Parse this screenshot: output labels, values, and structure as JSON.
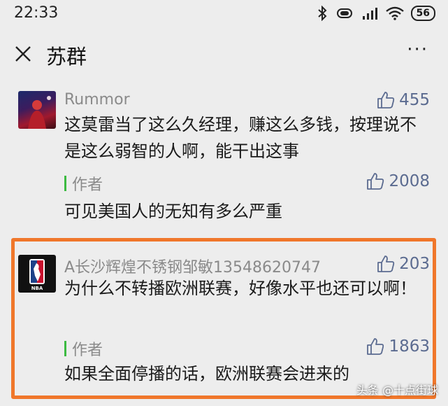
{
  "status_bar": {
    "time": "22:33",
    "battery": "56"
  },
  "header": {
    "title": "苏群",
    "more": "···"
  },
  "comments": [
    {
      "user": "Rummor",
      "likes": "455",
      "text": "这莫雷当了这么久经理，赚这么多钱，按理说不是这么弱智的人啊，能干出这事",
      "reply_tag": "作者",
      "reply_likes": "2008",
      "reply_text": "可见美国人的无知有多么严重"
    },
    {
      "user": "A长沙辉煌不锈钢邹敏13548620747",
      "likes": "203",
      "text": "为什么不转播欧洲联赛，好像水平也还可以啊！",
      "reply_tag": "作者",
      "reply_likes": "1863",
      "reply_text": "如果全面停播的话，欧洲联赛会进来的"
    }
  ],
  "watermark": "头条 @十点街球",
  "colors": {
    "highlight": "#f0772b",
    "like": "#5b6b90",
    "author_bar": "#3dbb42"
  },
  "icons": [
    "bluetooth-icon",
    "vibrate-icon",
    "signal-icon",
    "wifi-icon",
    "battery-icon",
    "close-icon",
    "more-icon",
    "thumbs-up-icon",
    "nba-logo-icon"
  ]
}
